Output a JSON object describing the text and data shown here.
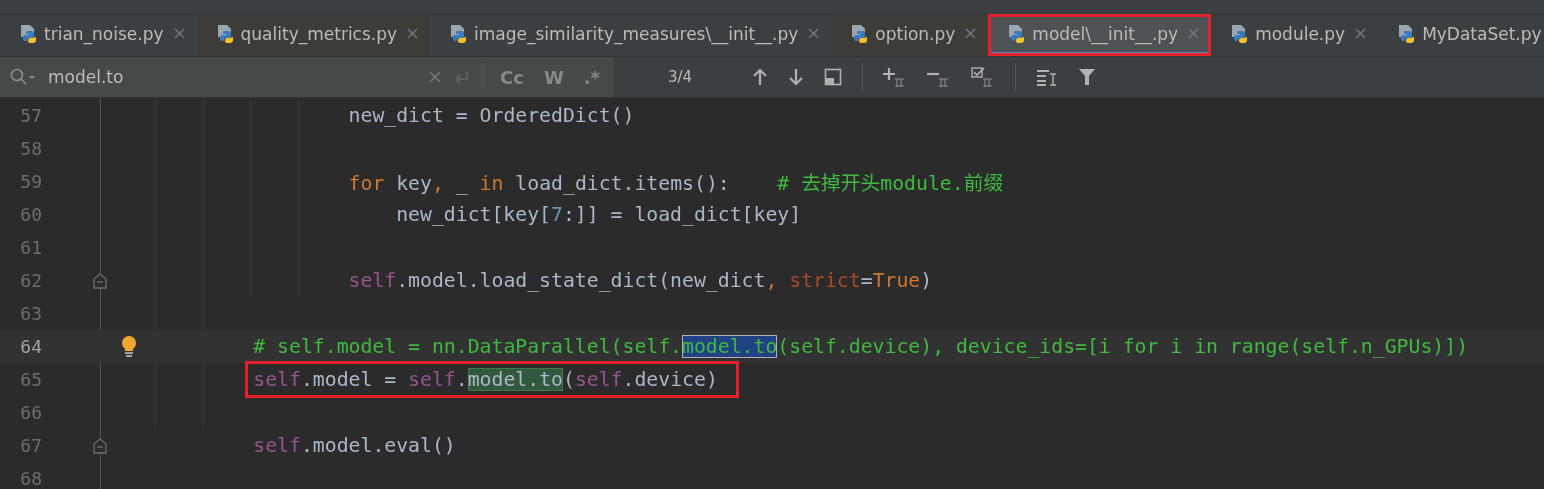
{
  "tabs": [
    {
      "label": "trian_noise.py",
      "selected": false,
      "highlighted": false,
      "closable": true
    },
    {
      "label": "quality_metrics.py",
      "selected": false,
      "highlighted": false,
      "closable": true
    },
    {
      "label": "image_similarity_measures\\__init__.py",
      "selected": false,
      "highlighted": false,
      "closable": true
    },
    {
      "label": "option.py",
      "selected": false,
      "highlighted": false,
      "closable": true
    },
    {
      "label": "model\\__init__.py",
      "selected": true,
      "highlighted": true,
      "closable": true
    },
    {
      "label": "module.py",
      "selected": false,
      "highlighted": false,
      "closable": true
    },
    {
      "label": "MyDataSet.py",
      "selected": false,
      "highlighted": false,
      "closable": false
    }
  ],
  "search": {
    "value": "model.to",
    "options": [
      {
        "label": "Cc",
        "on": false
      },
      {
        "label": "W",
        "on": false
      },
      {
        "label": ".*",
        "on": false
      }
    ],
    "match_count": "3/4"
  },
  "editor": {
    "lines": [
      {
        "number": "57",
        "current": false,
        "fold": false,
        "bulb": false,
        "highlighted": false,
        "tokens": [
          {
            "text": "                new_dict = OrderedDict()",
            "kind": "plain"
          }
        ]
      },
      {
        "number": "58",
        "current": false,
        "fold": false,
        "bulb": false
      },
      {
        "number": "59",
        "current": false,
        "fold": false,
        "bulb": false,
        "highlighted": false,
        "tokens": [
          {
            "text": "                for",
            "kind": "keyword"
          },
          {
            "text": " key",
            "kind": "plain"
          },
          {
            "text": ",",
            "kind": "keyword"
          },
          {
            "text": " _ ",
            "kind": "plain"
          },
          {
            "text": "in",
            "kind": "keyword"
          },
          {
            "text": " load_dict.items():    ",
            "kind": "plain"
          },
          {
            "text": "# 去掉开头module.前缀",
            "kind": "comment"
          }
        ]
      },
      {
        "number": "60",
        "current": false,
        "fold": false,
        "bulb": false,
        "highlighted": false,
        "tokens": [
          {
            "text": "                    new_dict[key[",
            "kind": "plain"
          },
          {
            "text": "7",
            "kind": "number"
          },
          {
            "text": ":]] = load_dict[key]",
            "kind": "plain"
          }
        ]
      },
      {
        "number": "61",
        "current": false,
        "fold": false,
        "bulb": false
      },
      {
        "number": "62",
        "current": false,
        "fold": true,
        "bulb": false,
        "highlighted": false,
        "tokens": [
          {
            "text": "                self",
            "kind": "self"
          },
          {
            "text": ".model.load_state_dict(new_dict",
            "kind": "plain"
          },
          {
            "text": ", ",
            "kind": "keyword"
          },
          {
            "text": "strict",
            "kind": "param"
          },
          {
            "text": "=",
            "kind": "plain"
          },
          {
            "text": "True",
            "kind": "keyword"
          },
          {
            "text": ")",
            "kind": "plain"
          }
        ]
      },
      {
        "number": "63",
        "current": false,
        "fold": false,
        "bulb": false
      },
      {
        "number": "64",
        "current": true,
        "fold": false,
        "bulb": true,
        "highlighted": false,
        "tokens": [
          {
            "text": "        # self.model = nn.DataParallel(self.",
            "kind": "comment"
          },
          {
            "text": "model.to",
            "kind": "current_match"
          },
          {
            "text": "(self.device), device_ids=[i for i in range(self.n_GPUs)])",
            "kind": "comment"
          }
        ]
      },
      {
        "number": "65",
        "current": false,
        "fold": false,
        "bulb": false,
        "highlighted": true,
        "tokens": [
          {
            "text": "        self",
            "kind": "self"
          },
          {
            "text": ".model = ",
            "kind": "plain"
          },
          {
            "text": "self",
            "kind": "self"
          },
          {
            "text": ".",
            "kind": "plain"
          },
          {
            "text": "model.to",
            "kind": "match"
          },
          {
            "text": "(",
            "kind": "plain"
          },
          {
            "text": "self",
            "kind": "self"
          },
          {
            "text": ".device)",
            "kind": "plain"
          }
        ]
      },
      {
        "number": "66",
        "current": false,
        "fold": false,
        "bulb": false
      },
      {
        "number": "67",
        "current": false,
        "fold": true,
        "bulb": false,
        "highlighted": false,
        "tokens": [
          {
            "text": "        self",
            "kind": "self"
          },
          {
            "text": ".model.eval()",
            "kind": "plain"
          }
        ]
      },
      {
        "number": "68",
        "current": false,
        "fold": false,
        "bulb": false
      }
    ]
  }
}
